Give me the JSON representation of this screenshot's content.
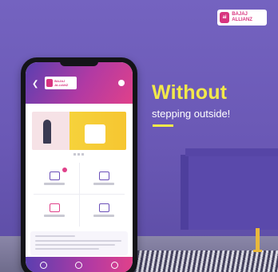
{
  "brand": {
    "logo_text": "ai",
    "name": "BAJAJ ALLIANZ"
  },
  "headline": {
    "title": "Without",
    "subtitle": "stepping outside!"
  },
  "colors": {
    "wall": "#6d5bb6",
    "accent_yellow": "#f2e94a",
    "brand_pink": "#d8347f",
    "app_gradient_start": "#5b3fb0",
    "app_gradient_end": "#e0418a"
  },
  "phone": {
    "icons": [
      "back-arrow-icon",
      "menu-icon",
      "policy-icon",
      "renew-icon",
      "claims-icon",
      "offers-icon",
      "home-icon",
      "chat-icon",
      "profile-icon"
    ]
  }
}
